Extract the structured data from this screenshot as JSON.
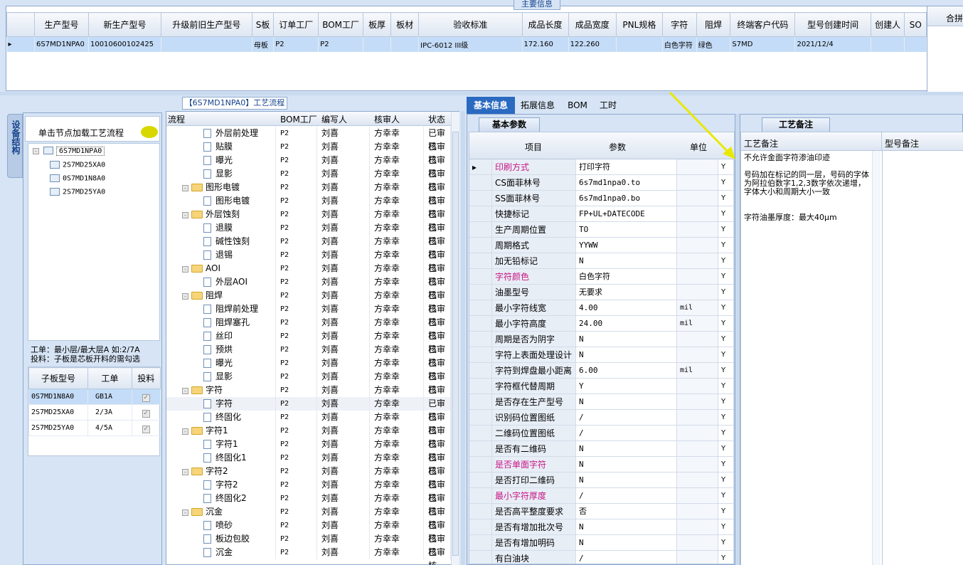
{
  "top_section": {
    "title": "主要信息",
    "columns": [
      "生产型号",
      "新生产型号",
      "升级前旧生产型号",
      "S板",
      "订单工厂",
      "BOM工厂",
      "板厚",
      "板材",
      "验收标准",
      "成品长度",
      "成品宽度",
      "PNL规格",
      "字符",
      "阻焊",
      "终端客户代码",
      "型号创建时间",
      "创建人",
      "SO"
    ],
    "right_label": "合拼",
    "row": [
      "6S7MD1NPA0",
      "10010600102425",
      "",
      "母板",
      "P2",
      "P2",
      "",
      "",
      "IPC-6012 III级",
      "172.160",
      "122.260",
      "",
      "白色字符",
      "绿色",
      "S7MD",
      "2021/12/4",
      "",
      ""
    ]
  },
  "flow_title": "【6S7MD1NPA0】工艺流程",
  "side_tab": "设备结构",
  "left": {
    "load_label": "单击节点加载工艺流程",
    "tree_root": "6S7MD1NPA0",
    "tree_children": [
      "2S7MD25XA0",
      "0S7MD1N8A0",
      "2S7MD25YA0"
    ],
    "note1": "工单：最小层/最大层A 如:2/7A",
    "note2": "投料：子板是芯板开料的需勾选",
    "sub_headers": [
      "子板型号",
      "工单",
      "投料"
    ],
    "sub_rows": [
      {
        "model": "0S7MD1N8A0",
        "order": "GB1A",
        "check": "✓"
      },
      {
        "model": "2S7MD25XA0",
        "order": "2/3A",
        "check": "✓"
      },
      {
        "model": "2S7MD25YA0",
        "order": "4/5A",
        "check": "✓"
      }
    ]
  },
  "process": {
    "headers": [
      "流程",
      "BOM工厂",
      "编写人",
      "核审人",
      "状态"
    ],
    "rows": [
      {
        "name": "外层前处理",
        "level": 2,
        "folder": false,
        "bom": "P2",
        "writer": "刘喜",
        "reviewer": "方幸幸",
        "status": "已审核"
      },
      {
        "name": "贴膜",
        "level": 2,
        "folder": false,
        "bom": "P2",
        "writer": "刘喜",
        "reviewer": "方幸幸",
        "status": "已审核"
      },
      {
        "name": "曝光",
        "level": 2,
        "folder": false,
        "bom": "P2",
        "writer": "刘喜",
        "reviewer": "方幸幸",
        "status": "已审核"
      },
      {
        "name": "显影",
        "level": 2,
        "folder": false,
        "bom": "P2",
        "writer": "刘喜",
        "reviewer": "方幸幸",
        "status": "已审核"
      },
      {
        "name": "图形电镀",
        "level": 1,
        "folder": true,
        "bom": "P2",
        "writer": "刘喜",
        "reviewer": "方幸幸",
        "status": "已审核"
      },
      {
        "name": "图形电镀",
        "level": 2,
        "folder": false,
        "bom": "P2",
        "writer": "刘喜",
        "reviewer": "方幸幸",
        "status": "已审核"
      },
      {
        "name": "外层蚀刻",
        "level": 1,
        "folder": true,
        "bom": "P2",
        "writer": "刘喜",
        "reviewer": "方幸幸",
        "status": "已审核"
      },
      {
        "name": "退膜",
        "level": 2,
        "folder": false,
        "bom": "P2",
        "writer": "刘喜",
        "reviewer": "方幸幸",
        "status": "已审核"
      },
      {
        "name": "碱性蚀刻",
        "level": 2,
        "folder": false,
        "bom": "P2",
        "writer": "刘喜",
        "reviewer": "方幸幸",
        "status": "已审核"
      },
      {
        "name": "退锡",
        "level": 2,
        "folder": false,
        "bom": "P2",
        "writer": "刘喜",
        "reviewer": "方幸幸",
        "status": "已审核"
      },
      {
        "name": "AOI",
        "level": 1,
        "folder": true,
        "bom": "P2",
        "writer": "刘喜",
        "reviewer": "方幸幸",
        "status": "已审核"
      },
      {
        "name": "外层AOI",
        "level": 2,
        "folder": false,
        "bom": "P2",
        "writer": "刘喜",
        "reviewer": "方幸幸",
        "status": "已审核"
      },
      {
        "name": "阻焊",
        "level": 1,
        "folder": true,
        "bom": "P2",
        "writer": "刘喜",
        "reviewer": "方幸幸",
        "status": "已审核"
      },
      {
        "name": "阻焊前处理",
        "level": 2,
        "folder": false,
        "bom": "P2",
        "writer": "刘喜",
        "reviewer": "方幸幸",
        "status": "已审核"
      },
      {
        "name": "阻焊塞孔",
        "level": 2,
        "folder": false,
        "bom": "P2",
        "writer": "刘喜",
        "reviewer": "方幸幸",
        "status": "已审核"
      },
      {
        "name": "丝印",
        "level": 2,
        "folder": false,
        "bom": "P2",
        "writer": "刘喜",
        "reviewer": "方幸幸",
        "status": "已审核"
      },
      {
        "name": "预烘",
        "level": 2,
        "folder": false,
        "bom": "P2",
        "writer": "刘喜",
        "reviewer": "方幸幸",
        "status": "已审核"
      },
      {
        "name": "曝光",
        "level": 2,
        "folder": false,
        "bom": "P2",
        "writer": "刘喜",
        "reviewer": "方幸幸",
        "status": "已审核"
      },
      {
        "name": "显影",
        "level": 2,
        "folder": false,
        "bom": "P2",
        "writer": "刘喜",
        "reviewer": "方幸幸",
        "status": "已审核"
      },
      {
        "name": "字符",
        "level": 1,
        "folder": true,
        "bom": "P2",
        "writer": "刘喜",
        "reviewer": "方幸幸",
        "status": "已审核"
      },
      {
        "name": "字符",
        "level": 2,
        "folder": false,
        "bom": "P2",
        "writer": "刘喜",
        "reviewer": "方幸幸",
        "status": "已审核",
        "selected": true
      },
      {
        "name": "终固化",
        "level": 2,
        "folder": false,
        "bom": "P2",
        "writer": "刘喜",
        "reviewer": "方幸幸",
        "status": "已审核"
      },
      {
        "name": "字符1",
        "level": 1,
        "folder": true,
        "bom": "P2",
        "writer": "刘喜",
        "reviewer": "方幸幸",
        "status": "已审核"
      },
      {
        "name": "字符1",
        "level": 2,
        "folder": false,
        "bom": "P2",
        "writer": "刘喜",
        "reviewer": "方幸幸",
        "status": "已审核"
      },
      {
        "name": "终固化1",
        "level": 2,
        "folder": false,
        "bom": "P2",
        "writer": "刘喜",
        "reviewer": "方幸幸",
        "status": "已审核"
      },
      {
        "name": "字符2",
        "level": 1,
        "folder": true,
        "bom": "P2",
        "writer": "刘喜",
        "reviewer": "方幸幸",
        "status": "已审核"
      },
      {
        "name": "字符2",
        "level": 2,
        "folder": false,
        "bom": "P2",
        "writer": "刘喜",
        "reviewer": "方幸幸",
        "status": "已审核"
      },
      {
        "name": "终固化2",
        "level": 2,
        "folder": false,
        "bom": "P2",
        "writer": "刘喜",
        "reviewer": "方幸幸",
        "status": "已审核"
      },
      {
        "name": "沉金",
        "level": 1,
        "folder": true,
        "bom": "P2",
        "writer": "刘喜",
        "reviewer": "方幸幸",
        "status": "已审核"
      },
      {
        "name": "喷砂",
        "level": 2,
        "folder": false,
        "bom": "P2",
        "writer": "刘喜",
        "reviewer": "方幸幸",
        "status": "已审核"
      },
      {
        "name": "板边包胶",
        "level": 2,
        "folder": false,
        "bom": "P2",
        "writer": "刘喜",
        "reviewer": "方幸幸",
        "status": "已审核"
      },
      {
        "name": "沉金",
        "level": 2,
        "folder": false,
        "bom": "P2",
        "writer": "刘喜",
        "reviewer": "方幸幸",
        "status": "已审核"
      }
    ]
  },
  "right_tabs": [
    "基本信息",
    "拓展信息",
    "BOM",
    "工时"
  ],
  "basic_params": {
    "group_title": "基本参数",
    "headers": [
      "项目",
      "参数",
      "单位"
    ],
    "rows": [
      {
        "item": "印刷方式",
        "value": "打印字符",
        "unit": "",
        "flag": "Y",
        "pink": true
      },
      {
        "item": "CS面菲林号",
        "value": "6s7md1npa0.to",
        "unit": "",
        "flag": "Y"
      },
      {
        "item": "SS面菲林号",
        "value": "6s7md1npa0.bo",
        "unit": "",
        "flag": "Y"
      },
      {
        "item": "快捷标记",
        "value": "FP+UL+DATECODE",
        "unit": "",
        "flag": "Y"
      },
      {
        "item": "生产周期位置",
        "value": "TO",
        "unit": "",
        "flag": "Y"
      },
      {
        "item": "周期格式",
        "value": "YYWW",
        "unit": "",
        "flag": "Y"
      },
      {
        "item": "加无铅标记",
        "value": "N",
        "unit": "",
        "flag": "Y"
      },
      {
        "item": "字符颜色",
        "value": "白色字符",
        "unit": "",
        "flag": "Y",
        "pink": true
      },
      {
        "item": "油墨型号",
        "value": "无要求",
        "unit": "",
        "flag": "Y"
      },
      {
        "item": "最小字符线宽",
        "value": "4.00",
        "unit": "mil",
        "flag": "Y"
      },
      {
        "item": "最小字符高度",
        "value": "24.00",
        "unit": "mil",
        "flag": "Y"
      },
      {
        "item": "周期是否为阴字",
        "value": "N",
        "unit": "",
        "flag": "Y"
      },
      {
        "item": "字符上表面处理设计",
        "value": "N",
        "unit": "",
        "flag": "Y"
      },
      {
        "item": "字符到焊盘最小距离",
        "value": "6.00",
        "unit": "mil",
        "flag": "Y"
      },
      {
        "item": "字符框代替周期",
        "value": "Y",
        "unit": "",
        "flag": "Y"
      },
      {
        "item": "是否存在生产型号",
        "value": "N",
        "unit": "",
        "flag": "Y"
      },
      {
        "item": "识别码位置图纸",
        "value": "/",
        "unit": "",
        "flag": "Y"
      },
      {
        "item": "二维码位置图纸",
        "value": "/",
        "unit": "",
        "flag": "Y"
      },
      {
        "item": "是否有二维码",
        "value": "N",
        "unit": "",
        "flag": "Y"
      },
      {
        "item": "是否单面字符",
        "value": "N",
        "unit": "",
        "flag": "Y",
        "pink": true
      },
      {
        "item": "是否打印二维码",
        "value": "N",
        "unit": "",
        "flag": "Y"
      },
      {
        "item": "最小字符厚度",
        "value": "/",
        "unit": "",
        "flag": "Y",
        "pink": true
      },
      {
        "item": "是否高平整度要求",
        "value": "否",
        "unit": "",
        "flag": "Y"
      },
      {
        "item": "是否有增加批次号",
        "value": "N",
        "unit": "",
        "flag": "Y"
      },
      {
        "item": "是否有增加明码",
        "value": "N",
        "unit": "",
        "flag": "Y"
      },
      {
        "item": "有白油块",
        "value": "/",
        "unit": "",
        "flag": "Y"
      }
    ]
  },
  "remarks": {
    "tab_title": "工艺备注",
    "col1": "工艺备注",
    "col2": "型号备注",
    "line1": "不允许金面字符渗油印迹",
    "line2": "号码加在标记的同一层，号码的字体为阿拉伯数字1,2,3数字依次递增，字体大小和周期大小一致",
    "line3": "字符油墨厚度：最大40μm"
  },
  "colors": {
    "accent": "#15428b",
    "pink": "#c71585",
    "selected": "#c4dcf7",
    "arrow": "#e8e800"
  }
}
